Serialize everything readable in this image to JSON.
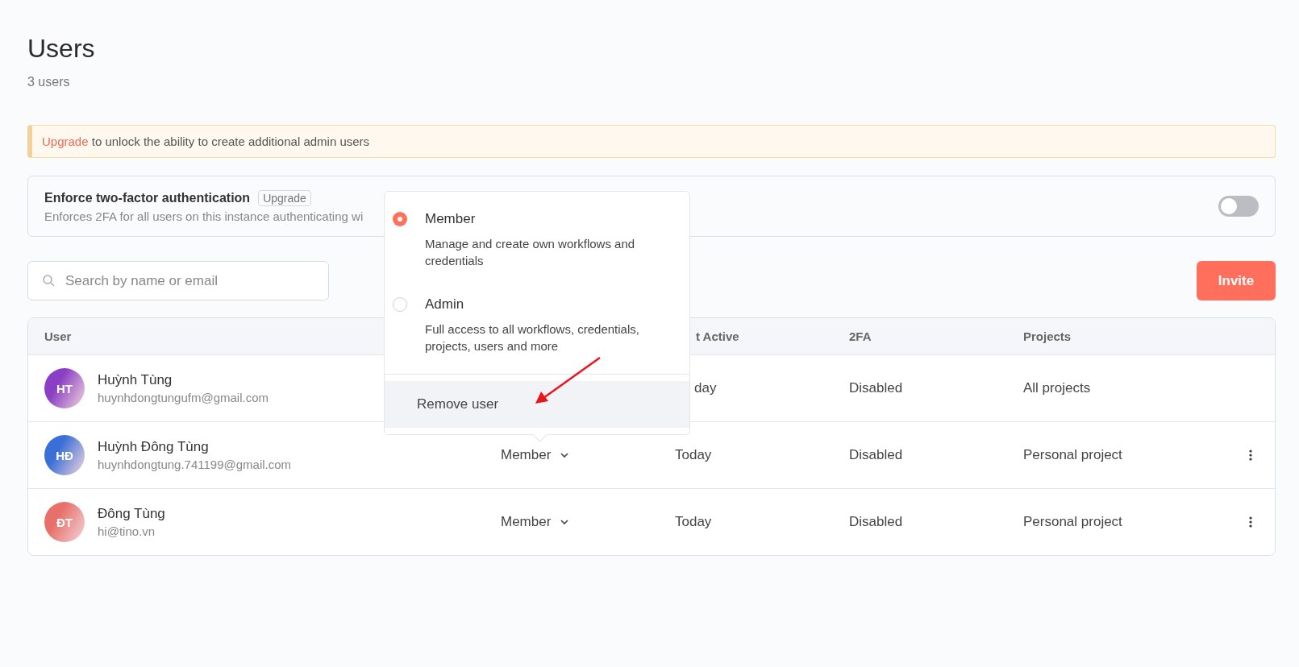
{
  "page": {
    "title": "Users",
    "subtitle": "3 users"
  },
  "banner": {
    "link": "Upgrade",
    "text": "to unlock the ability to create additional admin users"
  },
  "two_factor": {
    "title": "Enforce two-factor authentication",
    "badge": "Upgrade",
    "description": "Enforces 2FA for all users on this instance authenticating wi",
    "on": false
  },
  "search": {
    "placeholder": "Search by name or email"
  },
  "invite_button": "Invite",
  "table": {
    "columns": [
      "User",
      "t Active",
      "2FA",
      "Projects"
    ],
    "rows": [
      {
        "initials": "HT",
        "color": "#8a3fc4",
        "name": "Huỳnh Tùng",
        "email": "huynhdongtungufm@gmail.com",
        "last_active": "day",
        "twofa": "Disabled",
        "projects": "All projects",
        "menu": false
      },
      {
        "initials": "HĐ",
        "color": "#3b6fd8",
        "name": "Huỳnh Đông Tùng",
        "email": "huynhdongtung.741199@gmail.com",
        "role": "Member",
        "last_active": "Today",
        "twofa": "Disabled",
        "projects": "Personal project",
        "menu": true
      },
      {
        "initials": "ĐT",
        "color": "#e8706a",
        "name": "Đông Tùng",
        "email": "hi@tino.vn",
        "role": "Member",
        "last_active": "Today",
        "twofa": "Disabled",
        "projects": "Personal project",
        "menu": true
      }
    ]
  },
  "role_menu": {
    "options": [
      {
        "label": "Member",
        "description": "Manage and create own workflows and credentials",
        "selected": true
      },
      {
        "label": "Admin",
        "description": "Full access to all workflows, credentials, projects, users and more",
        "selected": false
      }
    ],
    "action": "Remove user"
  }
}
